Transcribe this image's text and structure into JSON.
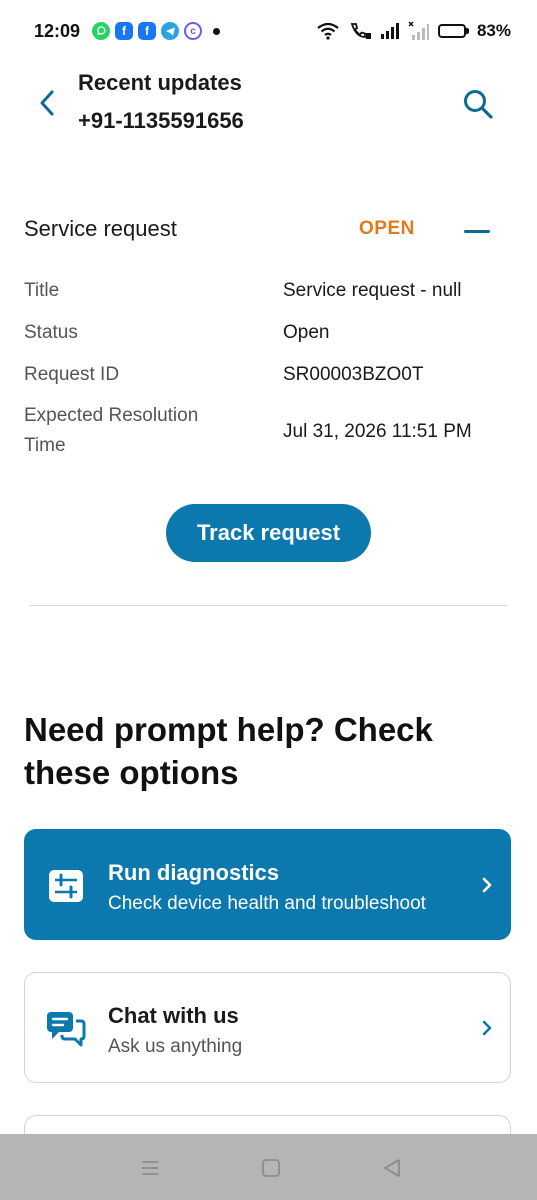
{
  "status_bar": {
    "time": "12:09",
    "battery_percent": "83%",
    "battery_level": 0.83,
    "apps": [
      "whatsapp-icon",
      "facebook-icon",
      "facebook-icon",
      "telegram-icon",
      "chrome-icon"
    ]
  },
  "header": {
    "title": "Recent updates",
    "subtitle": "+91-1135591656"
  },
  "service_request": {
    "label": "Service request",
    "status_badge": "OPEN",
    "status_color": "#e07b1a",
    "details": [
      {
        "key": "Title",
        "value": "Service request - null"
      },
      {
        "key": "Status",
        "value": "Open"
      },
      {
        "key": "Request ID",
        "value": "SR00003BZO0T"
      },
      {
        "key": "Expected Resolution",
        "key_line2": "Time",
        "value": "Jul 31, 2026 11:51 PM"
      }
    ],
    "track_button": "Track request"
  },
  "help": {
    "heading_line1": "Need prompt help? Check",
    "heading_line2": "these options",
    "options": [
      {
        "title": "Run diagnostics",
        "subtitle": "Check device health and troubleshoot",
        "icon": "sliders-icon"
      },
      {
        "title": "Chat with us",
        "subtitle": "Ask us anything",
        "icon": "chat-icon"
      }
    ]
  },
  "colors": {
    "accent": "#0b79ad",
    "status_open": "#e07b1a"
  }
}
